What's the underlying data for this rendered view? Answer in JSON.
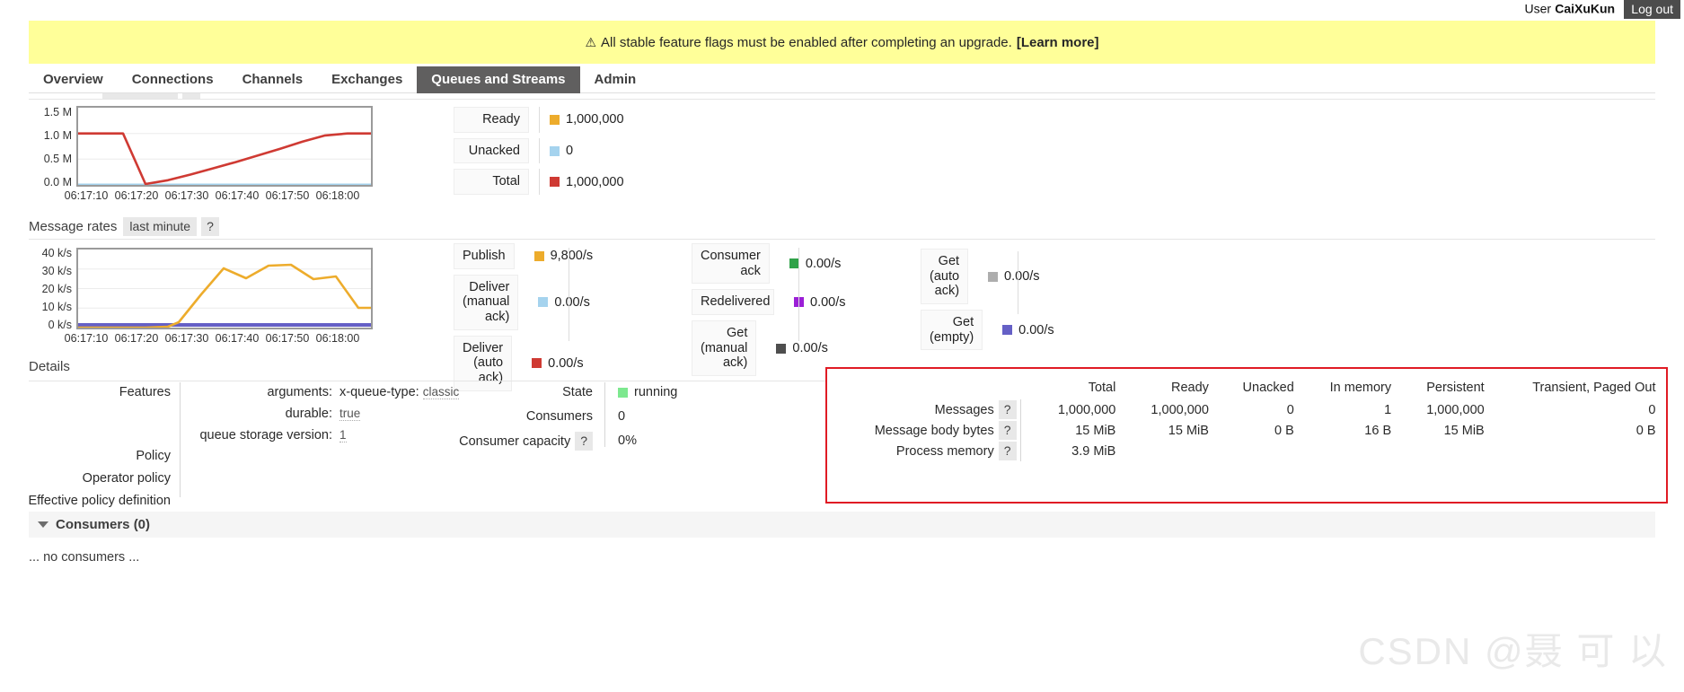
{
  "topbar": {
    "user_label": "User",
    "user_name": "CaiXuKun",
    "logout_label": "Log out"
  },
  "warning": {
    "icon": "warning-triangle-icon",
    "glyph": "⚠",
    "text": "All stable feature flags must be enabled after completing an upgrade.",
    "link_label": "[Learn more]",
    "background": "#ffff99"
  },
  "nav": {
    "tabs": [
      {
        "label": "Overview",
        "active": false
      },
      {
        "label": "Connections",
        "active": false
      },
      {
        "label": "Channels",
        "active": false
      },
      {
        "label": "Exchanges",
        "active": false
      },
      {
        "label": "Queues and Streams",
        "active": true
      },
      {
        "label": "Admin",
        "active": false
      }
    ],
    "active_background": "#605f5f"
  },
  "queued_messages": {
    "stats": [
      {
        "label": "Ready",
        "color": "#edac2c",
        "value": "1,000,000"
      },
      {
        "label": "Unacked",
        "color": "#a5d3ee",
        "value": "0"
      },
      {
        "label": "Total",
        "color": "#cf3a33",
        "value": "1,000,000"
      }
    ]
  },
  "message_rates": {
    "title": "Message rates",
    "period": "last minute",
    "help": "?",
    "col1": [
      {
        "label": "Publish",
        "color": "#edac2c",
        "value": "9,800/s"
      },
      {
        "label": "Deliver (manual ack)",
        "color": "#a5d3ee",
        "value": "0.00/s"
      },
      {
        "label": "Deliver (auto ack)",
        "color": "#cf3a33",
        "value": "0.00/s"
      }
    ],
    "col2": [
      {
        "label": "Consumer ack",
        "color": "#30a249",
        "value": "0.00/s"
      },
      {
        "label": "Redelivered",
        "color": "#9b1fd6",
        "value": "0.00/s"
      },
      {
        "label": "Get (manual ack)",
        "color": "#4e4e4e",
        "value": "0.00/s"
      }
    ],
    "col3": [
      {
        "label": "Get (auto ack)",
        "color": "#adadad",
        "value": "0.00/s"
      },
      {
        "label": "Get (empty)",
        "color": "#6560c6",
        "value": "0.00/s"
      }
    ]
  },
  "details": {
    "title": "Details",
    "left_labels": [
      "Features",
      "Policy",
      "Operator policy",
      "Effective policy definition"
    ],
    "features": [
      {
        "key": "arguments:",
        "sub": "x-queue-type:",
        "value": "classic"
      },
      {
        "key": "durable:",
        "sub": "",
        "value": "true"
      },
      {
        "key": "queue storage version:",
        "sub": "",
        "value": "1"
      }
    ],
    "state_rows": [
      {
        "label": "State",
        "help": "",
        "swatch": "#7de88f",
        "value": "running"
      },
      {
        "label": "Consumers",
        "help": "",
        "swatch": "",
        "value": "0"
      },
      {
        "label": "Consumer capacity",
        "help": "?",
        "swatch": "",
        "value": "0%"
      }
    ]
  },
  "messages_table": {
    "border_color": "#e01b24",
    "columns": [
      "Total",
      "Ready",
      "Unacked",
      "In memory",
      "Persistent",
      "Transient, Paged Out"
    ],
    "rows": [
      {
        "label": "Messages",
        "help": "?",
        "cells": [
          "1,000,000",
          "1,000,000",
          "0",
          "1",
          "1,000,000",
          "0"
        ]
      },
      {
        "label": "Message body bytes",
        "help": "?",
        "cells": [
          "15 MiB",
          "15 MiB",
          "0 B",
          "16 B",
          "15 MiB",
          "0 B"
        ]
      },
      {
        "label": "Process memory",
        "help": "?",
        "cells": [
          "3.9 MiB",
          "",
          "",
          "",
          "",
          ""
        ]
      }
    ]
  },
  "consumers": {
    "header": "Consumers (0)",
    "empty_text": "... no consumers ..."
  },
  "watermark": {
    "text": "CSDN @聂 可 以"
  },
  "chart_data": [
    {
      "type": "line",
      "id": "queued-messages-chart",
      "title": "Queued messages",
      "xlabel": "",
      "ylabel": "",
      "ylim": [
        0,
        1500000
      ],
      "yticks": [
        "0.0 M",
        "0.5 M",
        "1.0 M",
        "1.5 M"
      ],
      "ytick_values": [
        0,
        500000,
        1000000,
        1500000
      ],
      "xticks": [
        "06:17:10",
        "06:17:20",
        "06:17:30",
        "06:17:40",
        "06:17:50",
        "06:18:00"
      ],
      "grid": true,
      "legend": "right",
      "series": [
        {
          "name": "Total",
          "color": "#cf3a33",
          "x": [
            0,
            2,
            3,
            4,
            5,
            6,
            7,
            8,
            9,
            10,
            11,
            12,
            13
          ],
          "values": [
            1000000,
            1000000,
            1000000,
            20000,
            90000,
            200000,
            320000,
            440000,
            570000,
            700000,
            840000,
            960000,
            1000000
          ]
        },
        {
          "name": "Unacked",
          "color": "#a5d3ee",
          "x": [
            0,
            13
          ],
          "values": [
            0,
            0
          ]
        }
      ]
    },
    {
      "type": "line",
      "id": "message-rates-chart",
      "title": "Message rates",
      "xlabel": "",
      "ylabel": "",
      "ylim": [
        0,
        40000
      ],
      "yticks": [
        "0 k/s",
        "10 k/s",
        "20 k/s",
        "30 k/s",
        "40 k/s"
      ],
      "ytick_values": [
        0,
        10000,
        20000,
        30000,
        40000
      ],
      "xticks": [
        "06:17:10",
        "06:17:20",
        "06:17:30",
        "06:17:40",
        "06:17:50",
        "06:18:00"
      ],
      "grid": true,
      "legend": "right",
      "series": [
        {
          "name": "Publish",
          "color": "#edac2c",
          "x": [
            0,
            1,
            2,
            3,
            4,
            5,
            6,
            7,
            8,
            9,
            10,
            11,
            12,
            13
          ],
          "values": [
            0,
            0,
            0,
            0,
            400,
            2600,
            17000,
            30000,
            25500,
            31500,
            32000,
            24800,
            26200,
            10200
          ]
        },
        {
          "name": "Get (empty)",
          "color": "#6560c6",
          "x": [
            0,
            13
          ],
          "values": [
            0,
            0
          ]
        }
      ]
    }
  ]
}
